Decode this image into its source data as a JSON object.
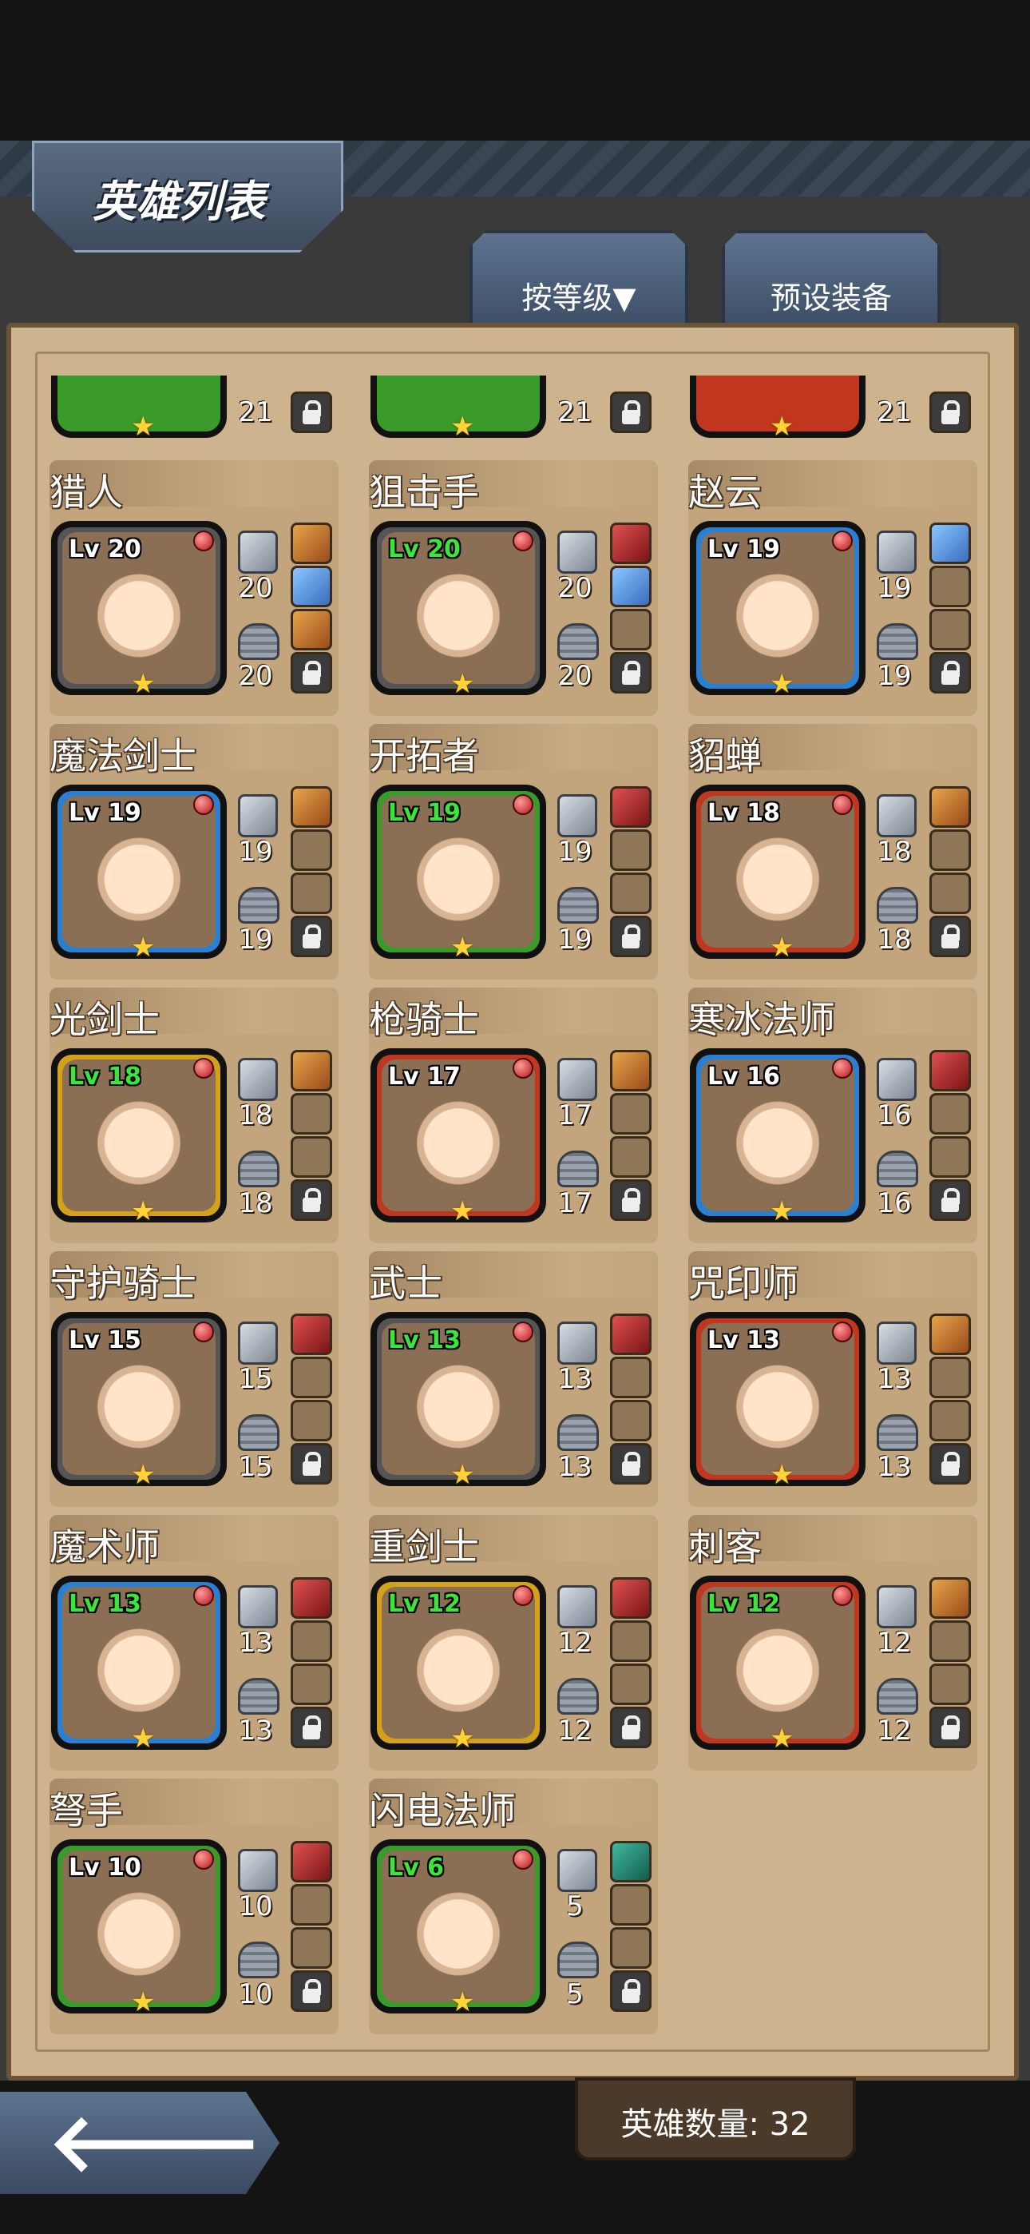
{
  "header": {
    "title": "英雄列表"
  },
  "tabs": [
    {
      "label": "按等级▼"
    },
    {
      "label": "预设装备"
    }
  ],
  "top_partial_row": [
    {
      "atk": "",
      "def": "21",
      "frame": "#3a9a2a"
    },
    {
      "atk": "",
      "def": "21",
      "frame": "#3a9a2a"
    },
    {
      "atk": "",
      "def": "21",
      "frame": "#c0361e"
    }
  ],
  "heroes": [
    {
      "name": "猎人",
      "level": "Lv 20",
      "level_color": "#ffffff",
      "atk": "20",
      "def": "20",
      "frame": "#555555",
      "slots": [
        "equip",
        "equip blue",
        "equip"
      ]
    },
    {
      "name": "狙击手",
      "level": "Lv 20",
      "level_color": "#39e639",
      "atk": "20",
      "def": "20",
      "frame": "#555555",
      "slots": [
        "equip red",
        "equip blue",
        "empty"
      ]
    },
    {
      "name": "赵云",
      "level": "Lv 19",
      "level_color": "#ffffff",
      "atk": "19",
      "def": "19",
      "frame": "#2b7fd0",
      "slots": [
        "equip blue",
        "empty",
        "empty"
      ]
    },
    {
      "name": "魔法剑士",
      "level": "Lv 19",
      "level_color": "#ffffff",
      "atk": "19",
      "def": "19",
      "frame": "#2b7fd0",
      "slots": [
        "equip",
        "empty",
        "empty"
      ]
    },
    {
      "name": "开拓者",
      "level": "Lv 19",
      "level_color": "#39e639",
      "atk": "19",
      "def": "19",
      "frame": "#3a9a2a",
      "slots": [
        "equip red",
        "empty",
        "empty"
      ]
    },
    {
      "name": "貂蝉",
      "level": "Lv 18",
      "level_color": "#ffffff",
      "atk": "18",
      "def": "18",
      "frame": "#c0361e",
      "slots": [
        "equip",
        "empty",
        "empty"
      ]
    },
    {
      "name": "光剑士",
      "level": "Lv 18",
      "level_color": "#39e639",
      "atk": "18",
      "def": "18",
      "frame": "#d4a21a",
      "slots": [
        "equip",
        "empty",
        "empty"
      ]
    },
    {
      "name": "枪骑士",
      "level": "Lv 17",
      "level_color": "#ffffff",
      "atk": "17",
      "def": "17",
      "frame": "#c0361e",
      "slots": [
        "equip",
        "empty",
        "empty"
      ]
    },
    {
      "name": "寒冰法师",
      "level": "Lv 16",
      "level_color": "#ffffff",
      "atk": "16",
      "def": "16",
      "frame": "#2b7fd0",
      "slots": [
        "equip red",
        "empty",
        "empty"
      ]
    },
    {
      "name": "守护骑士",
      "level": "Lv 15",
      "level_color": "#ffffff",
      "atk": "15",
      "def": "15",
      "frame": "#555555",
      "slots": [
        "equip red",
        "empty",
        "empty"
      ]
    },
    {
      "name": "武士",
      "level": "Lv 13",
      "level_color": "#39e639",
      "atk": "13",
      "def": "13",
      "frame": "#555555",
      "slots": [
        "equip red",
        "empty",
        "empty"
      ]
    },
    {
      "name": "咒印师",
      "level": "Lv 13",
      "level_color": "#ffffff",
      "atk": "13",
      "def": "13",
      "frame": "#c0361e",
      "slots": [
        "equip",
        "empty",
        "empty"
      ]
    },
    {
      "name": "魔术师",
      "level": "Lv 13",
      "level_color": "#39e639",
      "atk": "13",
      "def": "13",
      "frame": "#2b7fd0",
      "slots": [
        "equip red",
        "empty",
        "empty"
      ]
    },
    {
      "name": "重剑士",
      "level": "Lv 12",
      "level_color": "#39e639",
      "atk": "12",
      "def": "12",
      "frame": "#d4a21a",
      "slots": [
        "equip red",
        "empty",
        "empty"
      ]
    },
    {
      "name": "刺客",
      "level": "Lv 12",
      "level_color": "#39e639",
      "atk": "12",
      "def": "12",
      "frame": "#c0361e",
      "slots": [
        "equip",
        "empty",
        "empty"
      ]
    },
    {
      "name": "弩手",
      "level": "Lv 10",
      "level_color": "#ffffff",
      "atk": "10",
      "def": "10",
      "frame": "#3a9a2a",
      "slots": [
        "equip red",
        "empty",
        "empty"
      ]
    },
    {
      "name": "闪电法师",
      "level": "Lv 6",
      "level_color": "#39e639",
      "atk": "5",
      "def": "5",
      "frame": "#3a9a2a",
      "slots": [
        "equip teal",
        "empty",
        "empty"
      ]
    }
  ],
  "footer": {
    "hero_count": "英雄数量: 32",
    "back_arrow": "🡐"
  },
  "icons": {
    "back": "back-arrow-icon",
    "star": "star-icon",
    "lock": "lock-icon",
    "weapon": "sword-icon",
    "armor": "helmet-icon"
  }
}
